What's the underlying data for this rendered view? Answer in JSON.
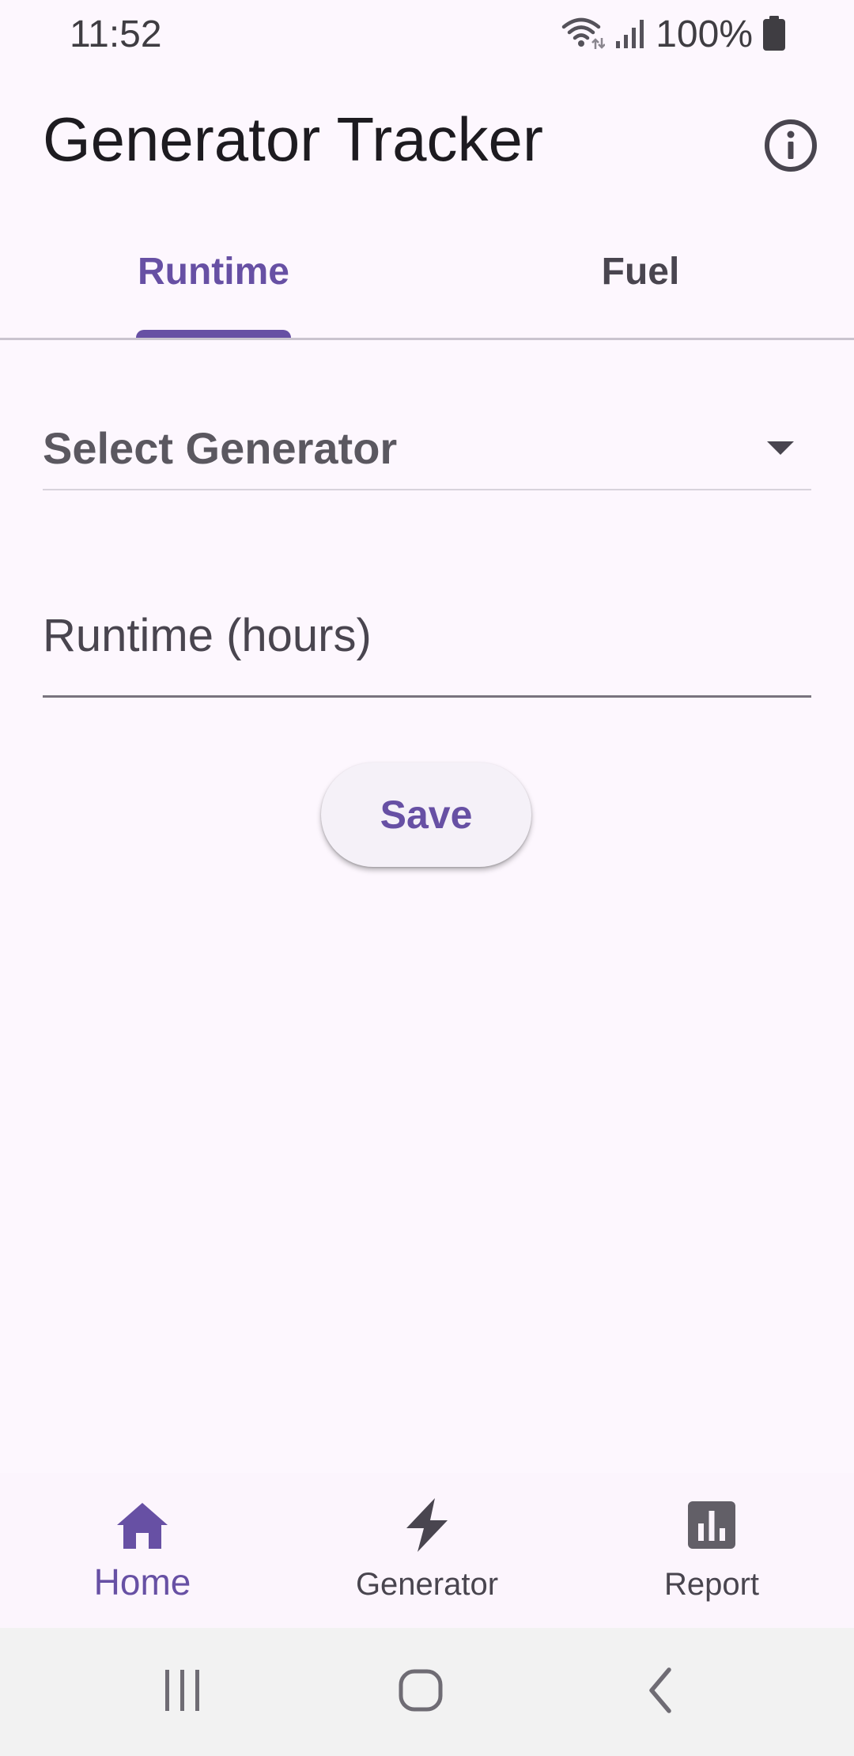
{
  "status_bar": {
    "time": "11:52",
    "battery_text": "100%",
    "icons": [
      "wifi-icon",
      "signal-icon",
      "battery-icon"
    ]
  },
  "app_bar": {
    "title": "Generator Tracker",
    "info_icon": "info-icon"
  },
  "tabs": [
    {
      "label": "Runtime",
      "selected": true
    },
    {
      "label": "Fuel",
      "selected": false
    }
  ],
  "form": {
    "generator_select": {
      "label": "Select Generator",
      "icon": "dropdown-arrow-icon"
    },
    "runtime_field": {
      "placeholder": "Runtime (hours)",
      "value": ""
    },
    "save_label": "Save"
  },
  "bottom_nav": {
    "items": [
      {
        "label": "Home",
        "icon": "home-icon",
        "selected": true
      },
      {
        "label": "Generator",
        "icon": "bolt-icon",
        "selected": false
      },
      {
        "label": "Report",
        "icon": "bar-chart-icon",
        "selected": false
      }
    ]
  },
  "system_nav": {
    "buttons": [
      "recent-apps-icon",
      "home-circle-icon",
      "back-icon"
    ]
  },
  "colors": {
    "accent": "#6750a4",
    "background": "#fdf7fe",
    "text_primary": "#1d1b20",
    "text_secondary": "#49454f",
    "divider": "#cac4cf",
    "system_nav_bg": "#f2f2f2"
  }
}
